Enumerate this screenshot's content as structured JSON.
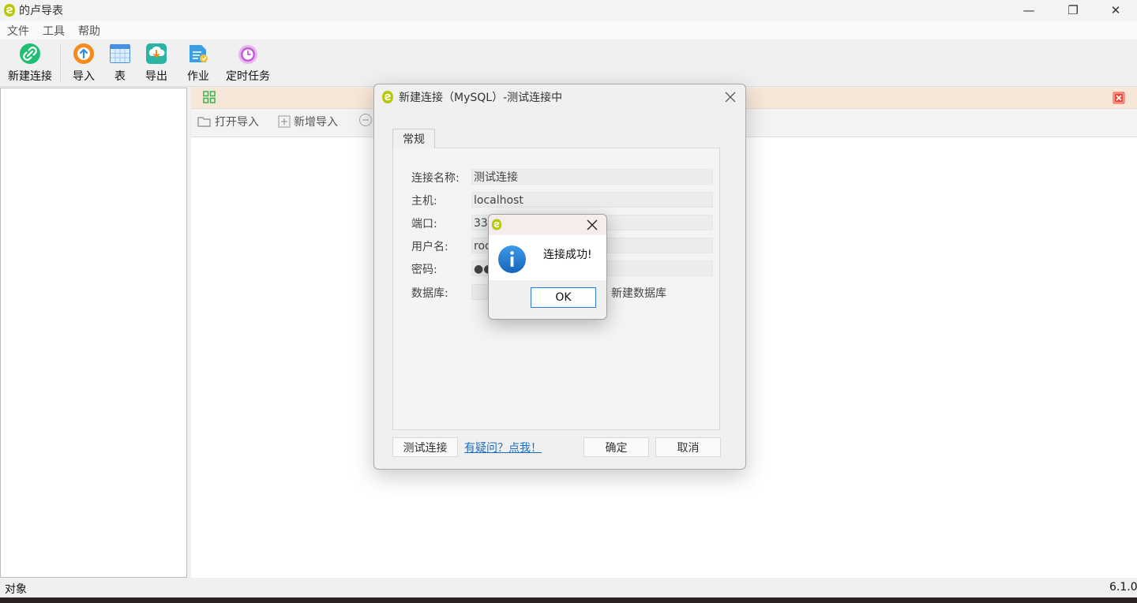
{
  "app": {
    "title": "的卢导表",
    "version": "6.1.0"
  },
  "window_controls": {
    "minimize": "—",
    "maximize": "❐",
    "close": "✕"
  },
  "menu": [
    "文件",
    "工具",
    "帮助"
  ],
  "toolbar": [
    {
      "label": "新建连接",
      "icon": "link-icon",
      "color": "#1fbe72"
    },
    {
      "label": "导入",
      "icon": "import-icon",
      "color": "#f58a1f"
    },
    {
      "label": "表",
      "icon": "table-icon",
      "color": "#4a90e2"
    },
    {
      "label": "导出",
      "icon": "export-icon",
      "color": "#2bb3a3"
    },
    {
      "label": "作业",
      "icon": "job-icon",
      "color": "#3aa0e6"
    },
    {
      "label": "定时任务",
      "icon": "clock-icon",
      "color": "#c65ad8"
    }
  ],
  "sub_toolbar": {
    "open_import": "打开导入",
    "add_import": "新增导入"
  },
  "status_bar": {
    "left": "对象"
  },
  "dialog": {
    "title": "新建连接（MySQL）-测试连接中",
    "tab": "常规",
    "fields": [
      {
        "label": "连接名称:",
        "value": "测试连接"
      },
      {
        "label": "主机:",
        "value": "localhost"
      },
      {
        "label": "端口:",
        "value": "330"
      },
      {
        "label": "用户名:",
        "value": "roo"
      },
      {
        "label": "密码:",
        "value": "●●"
      },
      {
        "label": "数据库:",
        "value": ""
      }
    ],
    "new_db_link": "新建数据库",
    "test_button": "测试连接",
    "help_link": "有疑问？点我！",
    "ok_button": "确定",
    "cancel_button": "取消"
  },
  "message_box": {
    "text": "连接成功!",
    "ok_button": "OK",
    "icon": "info-icon",
    "close": "✕"
  },
  "colors": {
    "accent": "#2f7ad7",
    "info_blue": "#1e7ad0",
    "orange_bar": "#f7e7d9",
    "close_red": "#e84a3a"
  }
}
